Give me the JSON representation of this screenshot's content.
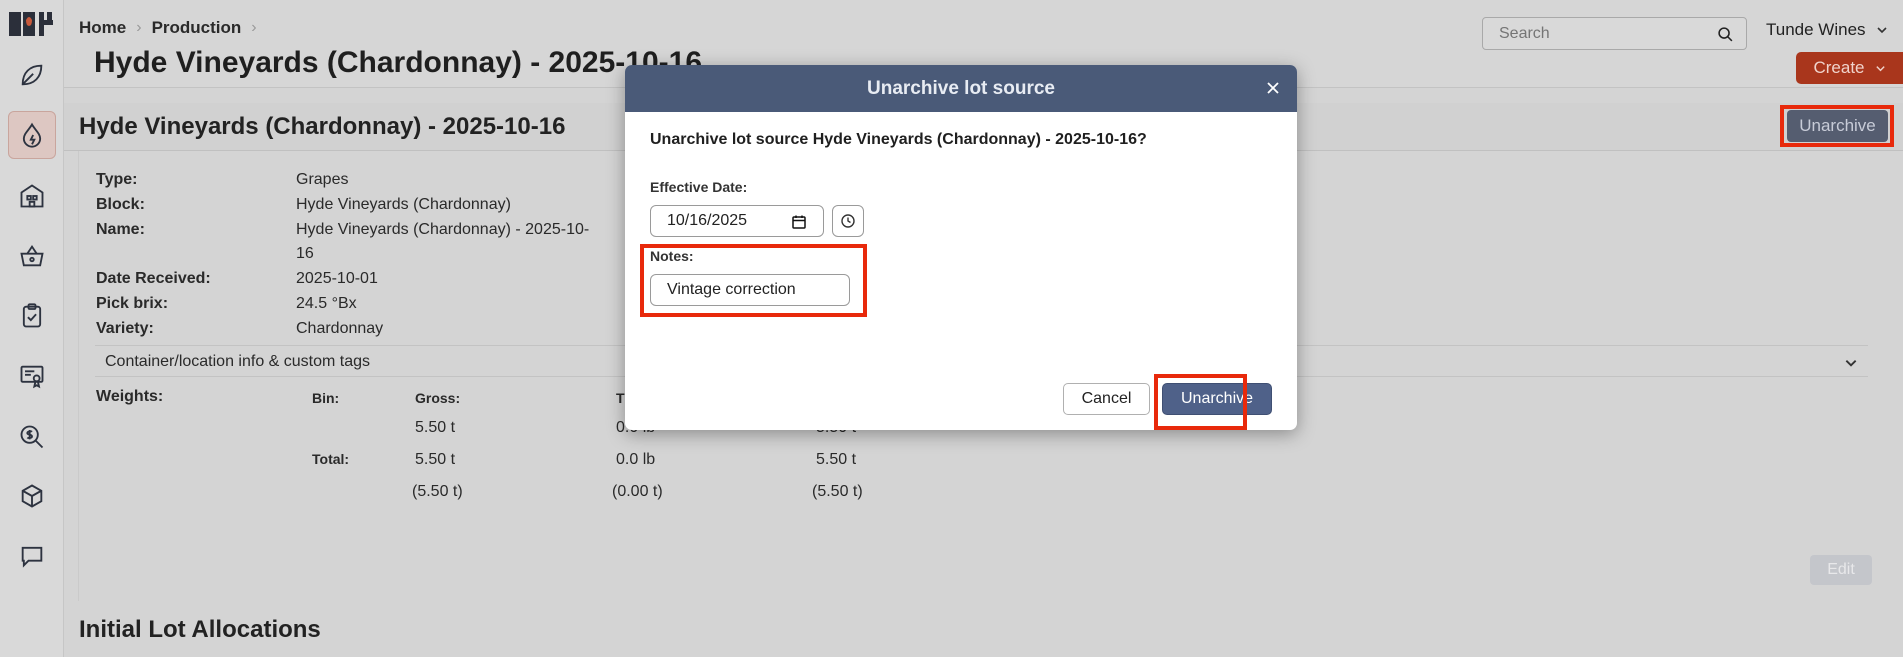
{
  "sidebar": {
    "logo_icon": "app-logo-icon",
    "items": [
      {
        "name": "leaf-icon",
        "active": false
      },
      {
        "name": "drop-icon",
        "active": true
      },
      {
        "name": "building-icon",
        "active": false
      },
      {
        "name": "basket-icon",
        "active": false
      },
      {
        "name": "clipboard-check-icon",
        "active": false
      },
      {
        "name": "certificate-icon",
        "active": false
      },
      {
        "name": "search-dollar-icon",
        "active": false
      },
      {
        "name": "box-icon",
        "active": false
      },
      {
        "name": "chat-icon",
        "active": false
      }
    ]
  },
  "header": {
    "breadcrumb": [
      "Home",
      "Production"
    ],
    "page_title": "Hyde Vineyards (Chardonnay) - 2025-10-16",
    "search_placeholder": "Search",
    "account_name": "Tunde Wines",
    "create_label": "Create"
  },
  "card": {
    "title": "Hyde Vineyards (Chardonnay) - 2025-10-16",
    "unarchive_label": "Unarchive",
    "details": [
      {
        "label": "Type:",
        "value": "Grapes"
      },
      {
        "label": "Block:",
        "value": "Hyde Vineyards (Chardonnay)"
      },
      {
        "label": "Name:",
        "value": "Hyde Vineyards (Chardonnay) - 2025-10-",
        "value2": "16"
      },
      {
        "label": "Date Received:",
        "value": "2025-10-01"
      },
      {
        "label": "Pick brix:",
        "value": "24.5 °Bx"
      },
      {
        "label": "Variety:",
        "value": "Chardonnay"
      }
    ],
    "accordion_label": "Container/location info & custom tags",
    "weights": {
      "label": "Weights:",
      "bin_header": "Bin:",
      "gross_header": "Gross:",
      "tare_header": "T",
      "row1": {
        "gross": "5.50 t",
        "tare": "0.0 lb",
        "net": "5.50 t"
      },
      "total_label": "Total:",
      "total": {
        "gross": "5.50 t",
        "tare": "0.0 lb",
        "net": "5.50 t"
      },
      "total_alt": {
        "gross": "(5.50 t)",
        "tare": "(0.00 t)",
        "net": "(5.50 t)"
      }
    },
    "edit_label": "Edit"
  },
  "section": {
    "title": "Initial Lot Allocations"
  },
  "modal": {
    "title": "Unarchive lot source",
    "question": "Unarchive lot source Hyde Vineyards (Chardonnay) - 2025-10-16?",
    "effective_date_label": "Effective Date:",
    "effective_date_value": "10/16/2025",
    "notes_label": "Notes:",
    "notes_value": "Vintage correction",
    "cancel_label": "Cancel",
    "confirm_label": "Unarchive"
  },
  "colors": {
    "highlight": "#e8290b",
    "modal_header": "#4a5a78",
    "primary_button": "#4f6189",
    "create_button": "#a9361c"
  }
}
